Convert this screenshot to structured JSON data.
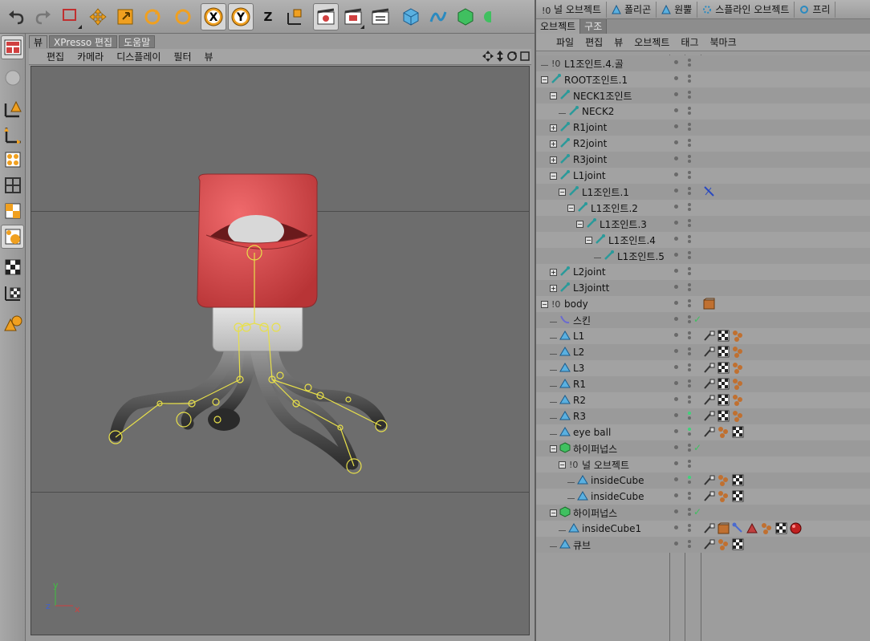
{
  "toolbar": {
    "icons": [
      "undo-icon",
      "redo-icon",
      "select-rect-icon",
      "move-icon",
      "scale-icon",
      "rotate-icon",
      "live-select-icon",
      "x-axis-icon",
      "y-axis-icon",
      "z-axis-icon",
      "world-coord-icon",
      "render-view-icon",
      "render-picture-icon",
      "render-settings-icon",
      "cube-icon",
      "spline-icon",
      "nurbs-icon",
      "more-icon"
    ],
    "axis_x": "X",
    "axis_y": "Y",
    "axis_z": "Z"
  },
  "viewport": {
    "tabs": [
      "뷰",
      "XPresso 편집",
      "도움말"
    ],
    "menu": [
      "편집",
      "카메라",
      "디스플레이",
      "필터",
      "뷰"
    ]
  },
  "right_panel": {
    "top_items": [
      "널 오브젝트",
      "폴리곤",
      "원뿔",
      "스플라인 오브젝트",
      "프리"
    ],
    "tabs": [
      "오브젝트",
      "구조"
    ],
    "menu": [
      "파일",
      "편집",
      "뷰",
      "오브젝트",
      "태그",
      "북마크"
    ]
  },
  "objects": [
    {
      "name": "L1조인트.4.골",
      "indent": 0,
      "type": "null"
    },
    {
      "name": "ROOT조인트.1",
      "indent": 0,
      "type": "joint",
      "exp": "-"
    },
    {
      "name": "NECK1조인트",
      "indent": 1,
      "type": "joint",
      "exp": "-"
    },
    {
      "name": "NECK2",
      "indent": 2,
      "type": "joint"
    },
    {
      "name": "R1joint",
      "indent": 1,
      "type": "joint",
      "exp": "+"
    },
    {
      "name": "R2joint",
      "indent": 1,
      "type": "joint",
      "exp": "+"
    },
    {
      "name": "R3joint",
      "indent": 1,
      "type": "joint",
      "exp": "+"
    },
    {
      "name": "L1joint",
      "indent": 1,
      "type": "joint",
      "exp": "-"
    },
    {
      "name": "L1조인트.1",
      "indent": 2,
      "type": "joint",
      "exp": "-",
      "tags": [
        "ik"
      ]
    },
    {
      "name": "L1조인트.2",
      "indent": 3,
      "type": "joint",
      "exp": "-"
    },
    {
      "name": "L1조인트.3",
      "indent": 4,
      "type": "joint",
      "exp": "-"
    },
    {
      "name": "L1조인트.4",
      "indent": 5,
      "type": "joint",
      "exp": "-"
    },
    {
      "name": "L1조인트.5",
      "indent": 6,
      "type": "joint"
    },
    {
      "name": "L2joint",
      "indent": 1,
      "type": "joint",
      "exp": "+"
    },
    {
      "name": "L3jointt",
      "indent": 1,
      "type": "joint",
      "exp": "+"
    },
    {
      "name": "body",
      "indent": 0,
      "type": "null",
      "exp": "-",
      "tags": [
        "box"
      ]
    },
    {
      "name": "스킨",
      "indent": 1,
      "type": "skin",
      "check": true
    },
    {
      "name": "L1",
      "indent": 1,
      "type": "poly",
      "tags": [
        "brush",
        "checker",
        "spheres"
      ]
    },
    {
      "name": "L2",
      "indent": 1,
      "type": "poly",
      "tags": [
        "brush",
        "checker",
        "spheres"
      ]
    },
    {
      "name": "L3",
      "indent": 1,
      "type": "poly",
      "tags": [
        "brush",
        "checker",
        "spheres"
      ]
    },
    {
      "name": "R1",
      "indent": 1,
      "type": "poly",
      "tags": [
        "brush",
        "checker",
        "spheres"
      ]
    },
    {
      "name": "R2",
      "indent": 1,
      "type": "poly",
      "tags": [
        "brush",
        "checker",
        "spheres"
      ]
    },
    {
      "name": "R3",
      "indent": 1,
      "type": "poly",
      "green": true,
      "tags": [
        "brush",
        "checker",
        "spheres"
      ]
    },
    {
      "name": "eye ball",
      "indent": 1,
      "type": "poly",
      "green": true,
      "tags": [
        "brush",
        "spheres",
        "checker"
      ]
    },
    {
      "name": "하이퍼넙스",
      "indent": 1,
      "type": "nurbs",
      "exp": "-",
      "check": true
    },
    {
      "name": "널 오브젝트",
      "indent": 2,
      "type": "null",
      "exp": "-"
    },
    {
      "name": "insideCube",
      "indent": 3,
      "type": "poly",
      "green": true,
      "tags": [
        "brush",
        "spheres",
        "checker"
      ]
    },
    {
      "name": "insideCube",
      "indent": 3,
      "type": "poly",
      "tags": [
        "brush",
        "spheres",
        "checker"
      ]
    },
    {
      "name": "하이퍼넙스",
      "indent": 1,
      "type": "nurbs",
      "exp": "-",
      "check": true
    },
    {
      "name": "insideCube1",
      "indent": 2,
      "type": "poly",
      "tags": [
        "brush",
        "box",
        "bone",
        "cone",
        "spheres",
        "checker",
        "ball"
      ]
    },
    {
      "name": "큐브",
      "indent": 1,
      "type": "poly",
      "tags": [
        "brush",
        "spheres",
        "checker"
      ]
    }
  ],
  "colors": {
    "head": "#d8494b",
    "neck": "#d4d4d4",
    "limb": "#5a5a5a",
    "joint": "#e8e04a",
    "viewport_bg": "#6d6d6d"
  }
}
